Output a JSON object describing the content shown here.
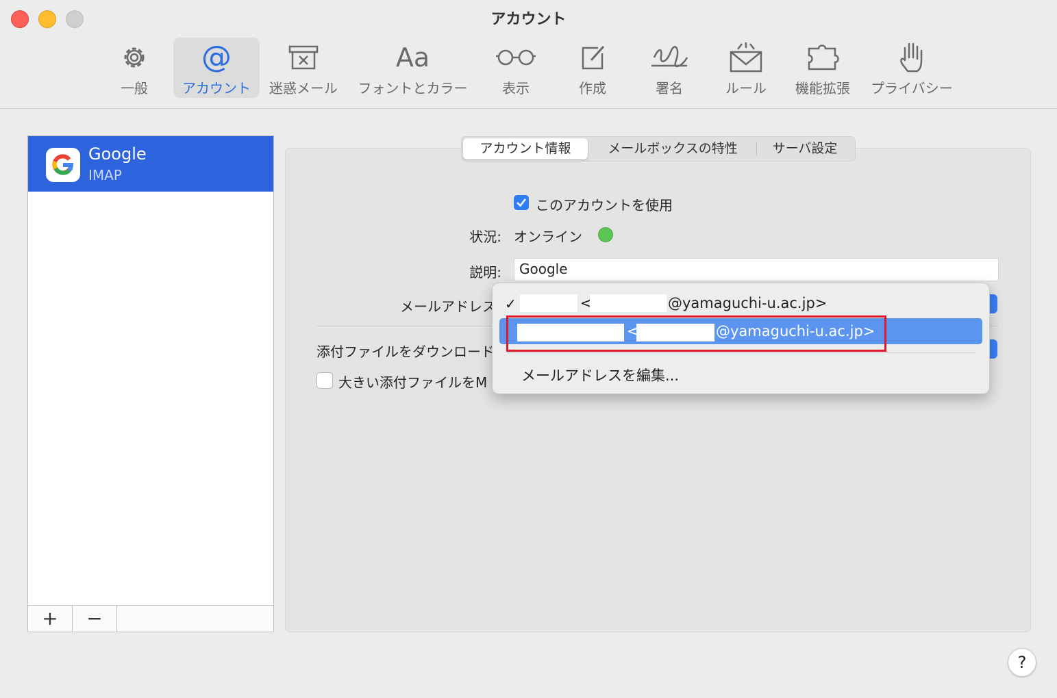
{
  "window": {
    "title": "アカウント"
  },
  "toolbar": {
    "items": [
      {
        "label": "一般",
        "icon": "gear-icon"
      },
      {
        "label": "アカウント",
        "icon": "at-sign-icon",
        "active": true
      },
      {
        "label": "迷惑メール",
        "icon": "junk-box-icon"
      },
      {
        "label": "フォントとカラー",
        "icon": "font-icon",
        "glyph": "Aa"
      },
      {
        "label": "表示",
        "icon": "glasses-icon"
      },
      {
        "label": "作成",
        "icon": "compose-icon"
      },
      {
        "label": "署名",
        "icon": "signature-icon"
      },
      {
        "label": "ルール",
        "icon": "rules-envelope-icon"
      },
      {
        "label": "機能拡張",
        "icon": "extension-icon"
      },
      {
        "label": "プライバシー",
        "icon": "hand-icon"
      }
    ],
    "at_glyph": "@"
  },
  "sidebar": {
    "accounts": [
      {
        "name": "Google",
        "type": "IMAP",
        "icon": "google-icon"
      }
    ],
    "add_label": "+",
    "remove_label": "−"
  },
  "tabs": {
    "items": [
      {
        "label": "アカウント情報",
        "selected": true
      },
      {
        "label": "メールボックスの特性"
      },
      {
        "label": "サーバ設定"
      }
    ]
  },
  "form": {
    "use_account_label": "このアカウントを使用",
    "use_account_checked": true,
    "status_label": "状況:",
    "status_value": "オンライン",
    "description_label": "説明:",
    "description_value": "Google",
    "email_label": "メールアドレス",
    "download_label": "添付ファイルをダウンロード",
    "large_attach_label": "大きい添付ファイルをM"
  },
  "email_menu": {
    "items": [
      {
        "open": "<",
        "domain": "@yamaguchi-u.ac.jp>",
        "checked": true
      },
      {
        "open": "<",
        "domain": "@yamaguchi-u.ac.jp>",
        "highlighted": true
      }
    ],
    "check_glyph": "✓",
    "edit_label": "メールアドレスを編集..."
  },
  "help": {
    "label": "?"
  },
  "colors": {
    "accent": "#2d63dc",
    "highlight": "#5b95f0",
    "status_online": "#5cc453",
    "annotation": "#e01a2a"
  }
}
